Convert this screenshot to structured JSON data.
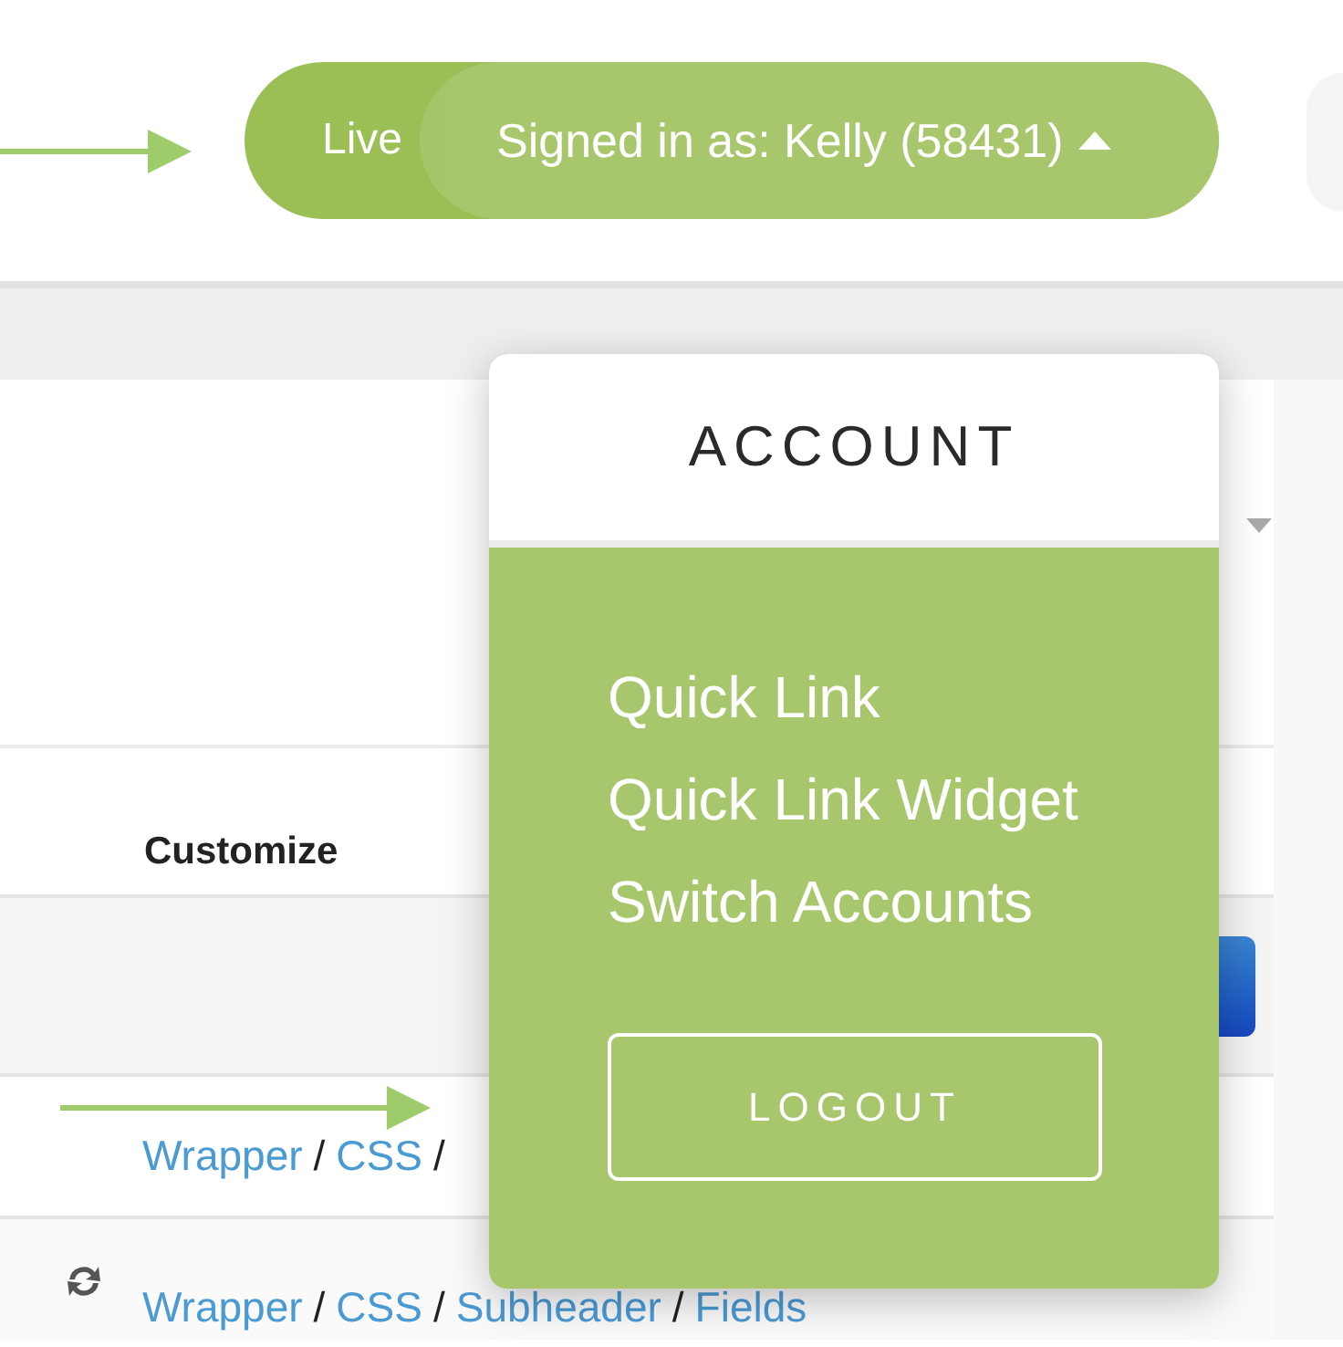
{
  "account_pill": {
    "environment": "Live",
    "signed_in_label": "Signed in as: Kelly (58431)",
    "expanded": true
  },
  "table": {
    "column_header": "Customize",
    "rows": [
      {
        "kind": "button_row"
      },
      {
        "kind": "path",
        "segments": [
          {
            "kind": "link",
            "text": "Wrapper"
          },
          {
            "kind": "separator",
            "text": "/"
          },
          {
            "kind": "link",
            "text": "CSS"
          },
          {
            "kind": "separator",
            "text": "/"
          }
        ]
      },
      {
        "kind": "refresh_path",
        "segments": [
          {
            "kind": "link",
            "text": "Wrapper"
          },
          {
            "kind": "separator",
            "text": "/"
          },
          {
            "kind": "link",
            "text": "CSS"
          },
          {
            "kind": "separator",
            "text": "/"
          },
          {
            "kind": "link",
            "text": "Subheader"
          },
          {
            "kind": "separator",
            "text": "/"
          },
          {
            "kind": "link",
            "text": "Fields"
          }
        ]
      }
    ]
  },
  "account_menu": {
    "title": "ACCOUNT",
    "items": [
      {
        "label": "Quick Link"
      },
      {
        "label": "Quick Link Widget"
      },
      {
        "label": "Switch Accounts"
      }
    ],
    "logout_button": "LOGOUT"
  }
}
